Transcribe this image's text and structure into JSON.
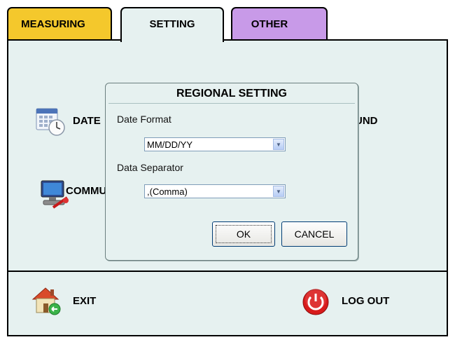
{
  "tabs": [
    {
      "label": "MEASURING",
      "color": "#f4c82c"
    },
    {
      "label": "SETTING",
      "color": "#e6f1f0"
    },
    {
      "label": "OTHER",
      "color": "#c89ae8"
    }
  ],
  "settings_items": {
    "date_label": "DATE",
    "comm_label": "COMMU",
    "sound_label": "UND"
  },
  "dialog": {
    "title": "REGIONAL SETTING",
    "date_format_label": "Date Format",
    "date_format_value": "MM/DD/YY",
    "separator_label": "Data Separator",
    "separator_value": ",(Comma)",
    "ok_label": "OK",
    "cancel_label": "CANCEL"
  },
  "bottom": {
    "exit_label": "EXIT",
    "logout_label": "LOG OUT"
  }
}
